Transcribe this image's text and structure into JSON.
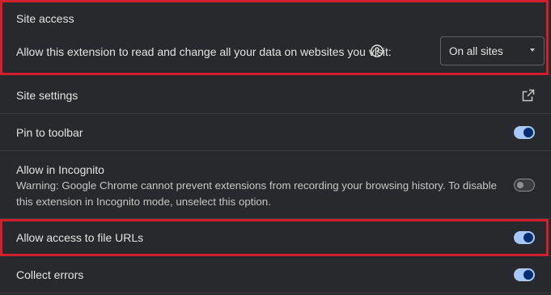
{
  "site_access": {
    "heading": "Site access",
    "description": "Allow this extension to read and change all your data on websites you visit:",
    "select_value": "On all sites"
  },
  "site_settings": {
    "label": "Site settings"
  },
  "pin_to_toolbar": {
    "label": "Pin to toolbar",
    "enabled": true
  },
  "incognito": {
    "label": "Allow in Incognito",
    "warning": "Warning: Google Chrome cannot prevent extensions from recording your browsing history. To disable this extension in Incognito mode, unselect this option.",
    "enabled": false
  },
  "file_urls": {
    "label": "Allow access to file URLs",
    "enabled": true
  },
  "collect_errors": {
    "label": "Collect errors",
    "enabled": true
  },
  "colors": {
    "highlight": "#d1202c",
    "toggle_on": "#a8c7fa",
    "toggle_knob_on": "#062e6f"
  }
}
